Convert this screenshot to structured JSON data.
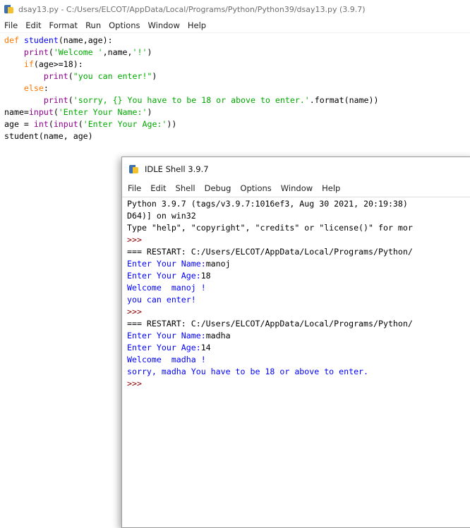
{
  "window": {
    "title": "dsay13.py - C:/Users/ELCOT/AppData/Local/Programs/Python/Python39/dsay13.py (3.9.7)"
  },
  "editor_menu": [
    "File",
    "Edit",
    "Format",
    "Run",
    "Options",
    "Window",
    "Help"
  ],
  "code": {
    "l1": {
      "a": "def",
      "b": " ",
      "c": "student",
      "d": "(name,age):"
    },
    "l2": {
      "a": "    ",
      "b": "print",
      "c": "(",
      "d": "'Welcome '",
      "e": ",name,",
      "f": "'!'",
      "g": ")"
    },
    "l3": {
      "a": "    ",
      "b": "if",
      "c": "(age>=18):"
    },
    "l4": {
      "a": "        ",
      "b": "print",
      "c": "(",
      "d": "\"you can enter!\"",
      "e": ")"
    },
    "l5": {
      "a": "    ",
      "b": "else",
      "c": ":"
    },
    "l6": {
      "a": "        ",
      "b": "print",
      "c": "(",
      "d": "'sorry, {} You have to be 18 or above to enter.'",
      "e": ".format(name))"
    },
    "l7": {
      "a": "name=",
      "b": "input",
      "c": "(",
      "d": "'Enter Your Name:'",
      "e": ")"
    },
    "l8": {
      "a": "age = ",
      "b": "int",
      "c": "(",
      "d": "input",
      "e": "(",
      "f": "'Enter Your Age:'",
      "g": "))"
    },
    "l9": {
      "a": "student(name, age)"
    }
  },
  "shell": {
    "title": "IDLE Shell 3.9.7",
    "menu": [
      "File",
      "Edit",
      "Shell",
      "Debug",
      "Options",
      "Window",
      "Help"
    ],
    "lines": [
      "Python 3.9.7 (tags/v3.9.7:1016ef3, Aug 30 2021, 20:19:38)",
      "D64)] on win32",
      "Type \"help\", \"copyright\", \"credits\" or \"license()\" for mor",
      ">>>",
      "=== RESTART: C:/Users/ELCOT/AppData/Local/Programs/Python/",
      "Enter Your Name:",
      "manoj",
      "Enter Your Age:",
      "18",
      "Welcome  manoj !",
      "you can enter!",
      ">>>",
      "=== RESTART: C:/Users/ELCOT/AppData/Local/Programs/Python/",
      "Enter Your Name:",
      "madha",
      "Enter Your Age:",
      "14",
      "Welcome  madha !",
      "sorry, madha You have to be 18 or above to enter.",
      ">>>"
    ]
  },
  "colors": {
    "keyword": "#ff7700",
    "builtin": "#900090",
    "def_name": "#0000ff",
    "string": "#00aa00",
    "stdout": "#0000ff",
    "prompt": "#8b0000"
  }
}
